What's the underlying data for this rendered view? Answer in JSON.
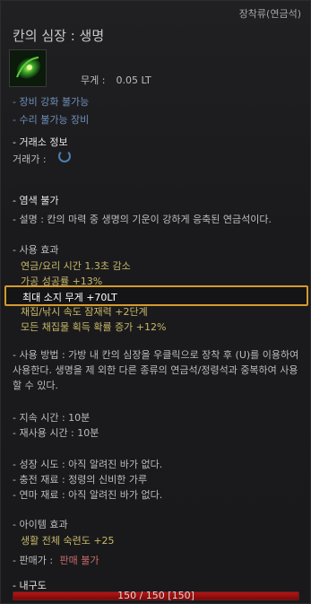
{
  "category": "장착류(연금석)",
  "title": "칸의 심장 : 생명",
  "weight_label": "무게 :",
  "weight_value": "0.05 LT",
  "notices": [
    "- 장비 강화 불가능",
    "- 수리 불가능 장비"
  ],
  "market_header": "- 거래소 정보",
  "price_label": "거래가 :",
  "dye": "- 염색 불가",
  "description": "- 설명 : 칸의 마력 중 생명의 기운이 강하게 응축된 연금석이다.",
  "effect_header": "- 사용 효과",
  "effects": [
    "연금/요리 시간 1.3초 감소",
    "가공 성공률 +13%",
    "최대 소지 무게 +70LT",
    "채집/낚시 속도 잠재력 +2단계",
    "모든 채집물 획득 확률 증가 +12%"
  ],
  "usage": "- 사용 방법 : 가방 내 칸의 심장을 우클릭으로 장착 후 (U)를 이용하여 사용한다. 생명을 제 외한 다른 종류의 연금석/정령석과 중복하여 사용할 수 있다.",
  "duration": "- 지속 시간 : 10분",
  "cooldown": "- 재사용 시간 : 10분",
  "growth": "- 성장 시도 : 아직 알려진 바가 없다.",
  "charge": "- 충전 재료 : 정령의 신비한 가루",
  "polish": "- 연마 재료 : 아직 알려진 바가 없다.",
  "item_effect_header": "- 아이템 효과",
  "item_effect": "생활 전체 숙련도 +25",
  "seller_label": "- 판매가 :",
  "seller_value": "판매 불가",
  "durability_label": "- 내구도",
  "durability_text": "150 / 150 [150]",
  "durability_fraction": 1.0,
  "icon": "alchemy-stone-green-icon",
  "colors": {
    "highlight_border": "#d39a2e",
    "effect_text": "#c8b86a",
    "durability_bar": "#b31616"
  }
}
